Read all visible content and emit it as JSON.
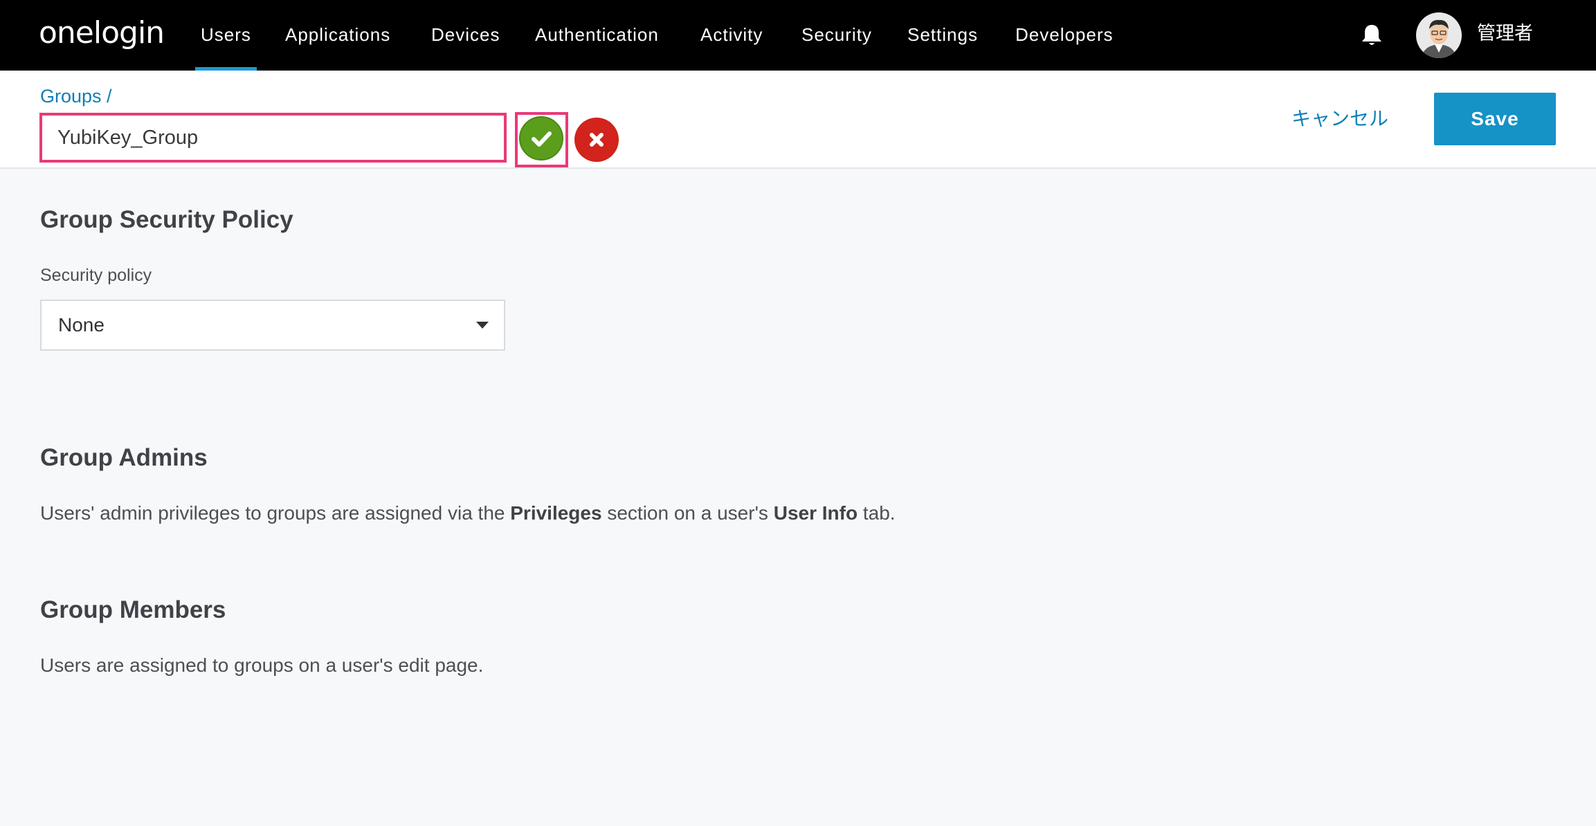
{
  "nav": {
    "logo": "onelogin",
    "items": [
      "Users",
      "Applications",
      "Devices",
      "Authentication",
      "Activity",
      "Security",
      "Settings",
      "Developers"
    ],
    "active": "Users",
    "user_name": "管理者",
    "bell_icon": "bell-icon"
  },
  "header": {
    "breadcrumb": "Groups /",
    "group_name": "YubiKey_Group",
    "cancel_label": "キャンセル",
    "save_label": "Save"
  },
  "policy": {
    "title": "Group Security Policy",
    "label": "Security policy",
    "selected": "None"
  },
  "admins": {
    "title": "Group Admins",
    "text_pre": "Users' admin privileges to groups are assigned via the ",
    "bold1": "Privileges",
    "text_mid": " section on a user's ",
    "bold2": "User Info",
    "text_post": " tab."
  },
  "members": {
    "title": "Group Members",
    "text": "Users are assigned to groups on a user's edit page."
  },
  "colors": {
    "accent": "#1592c6",
    "highlight": "#e83a78",
    "confirm": "#5a9e1c",
    "cancel": "#d2231c"
  }
}
